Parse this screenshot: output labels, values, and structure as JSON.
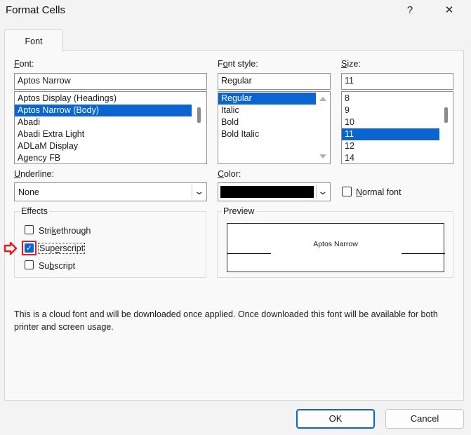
{
  "window": {
    "title": "Format Cells",
    "help_label": "?",
    "close_label": "✕"
  },
  "tabs": [
    {
      "label": "Font"
    }
  ],
  "font": {
    "label_prefix": "F",
    "label_rest": "ont:",
    "value": "Aptos Narrow",
    "items": [
      "Aptos Display (Headings)",
      "Aptos Narrow (Body)",
      "Abadi",
      "Abadi Extra Light",
      "ADLaM Display",
      "Agency FB"
    ],
    "selected_index": 1
  },
  "font_style": {
    "label_prefix": "F",
    "label_mid": "o",
    "label_rest": "nt style:",
    "value": "Regular",
    "items": [
      "Regular",
      "Italic",
      "Bold",
      "Bold Italic"
    ],
    "selected_index": 0
  },
  "size": {
    "label_prefix": "S",
    "label_rest": "ize:",
    "value": "11",
    "items": [
      "8",
      "9",
      "10",
      "11",
      "12",
      "14"
    ],
    "selected_index": 3
  },
  "underline": {
    "label_prefix": "U",
    "label_rest": "nderline:",
    "value": "None"
  },
  "color": {
    "label_prefix": "C",
    "label_rest": "olor:",
    "swatch": "#000000"
  },
  "normal_font": {
    "label_prefix": "N",
    "label_rest": "ormal font",
    "checked": false
  },
  "effects": {
    "legend": "Effects",
    "strikethrough": {
      "pre": "Stri",
      "key": "k",
      "post": "ethrough",
      "checked": false
    },
    "superscript": {
      "pre": "Sup",
      "key": "e",
      "post": "rscript",
      "checked": true
    },
    "subscript": {
      "pre": "Su",
      "key": "b",
      "post": "script",
      "checked": false
    }
  },
  "preview": {
    "legend": "Preview",
    "sample": "Aptos Narrow"
  },
  "note": "This is a cloud font and will be downloaded once applied. Once downloaded this font will be available for both printer and screen usage.",
  "buttons": {
    "ok": "OK",
    "cancel": "Cancel"
  },
  "colors": {
    "accent": "#0a64d1",
    "annotation": "#e02020"
  },
  "icons": {
    "help": "help-icon",
    "close": "close-icon",
    "dropdown": "chevron-down-icon",
    "pointer": "red-arrow-icon"
  }
}
